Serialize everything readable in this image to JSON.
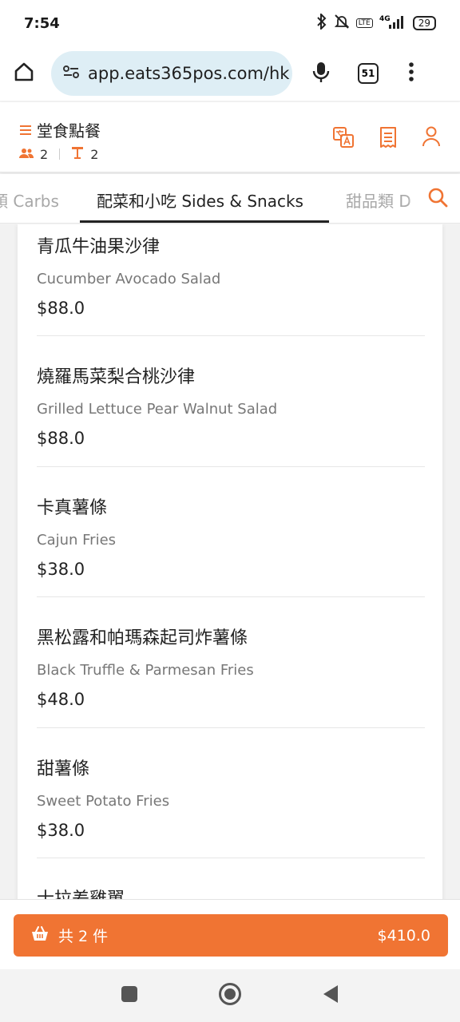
{
  "status": {
    "time": "7:54",
    "network": "4G",
    "battery": "29"
  },
  "browser": {
    "url": "app.eats365pos.com/hk",
    "tab_count": "51"
  },
  "header": {
    "title": "堂食點餐",
    "guests": "2",
    "table": "2"
  },
  "categories": {
    "prev": "類 Carbs",
    "active": "配菜和小吃 Sides & Snacks",
    "next": "甜品類 D"
  },
  "items": [
    {
      "zh": "青瓜牛油果沙律",
      "en": "Cucumber Avocado Salad",
      "price": "$88.0"
    },
    {
      "zh": "燒羅馬菜梨合桃沙律",
      "en": "Grilled Lettuce Pear Walnut Salad",
      "price": "$88.0"
    },
    {
      "zh": "卡真薯條",
      "en": "Cajun Fries",
      "price": "$38.0"
    },
    {
      "zh": "黑松露和帕瑪森起司炸薯條",
      "en": "Black Truffle & Parmesan Fries",
      "price": "$48.0"
    },
    {
      "zh": "甜薯條",
      "en": "Sweet Potato Fries",
      "price": "$38.0"
    },
    {
      "zh": "士拉差雞翼"
    }
  ],
  "cart": {
    "count_label": "共 2 件",
    "total": "$410.0"
  },
  "colors": {
    "accent": "#f07433"
  }
}
